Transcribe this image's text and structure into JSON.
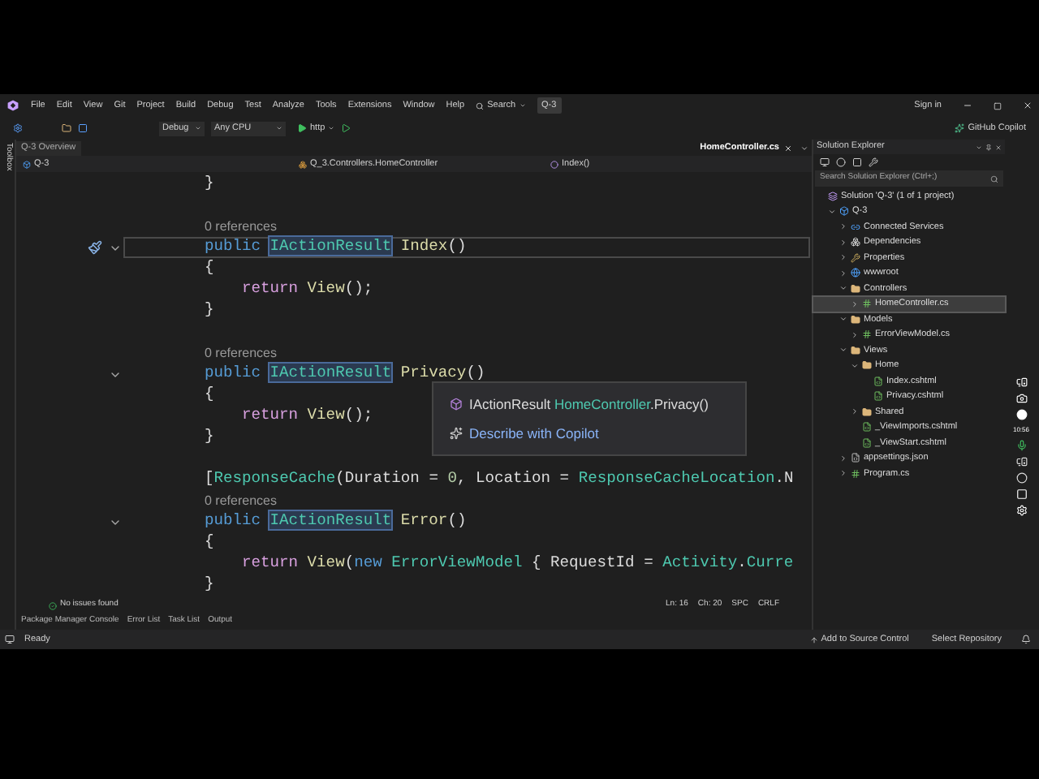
{
  "menu": {
    "items": [
      "File",
      "Edit",
      "View",
      "Git",
      "Project",
      "Build",
      "Debug",
      "Test",
      "Analyze",
      "Tools",
      "Extensions",
      "Window",
      "Help"
    ],
    "search_label": "Search",
    "solution_badge": "Q-3",
    "account": "Sign in"
  },
  "toolbar": {
    "configuration": "Debug",
    "platform": "Any CPU",
    "run_target": "http",
    "copilot_label": "GitHub Copilot"
  },
  "toolbox_label": "Toolbox",
  "document_tabs": [
    {
      "label": "Q-3 Overview",
      "selected": false
    },
    {
      "label": "HomeController.cs",
      "selected": true
    }
  ],
  "nav_bar": {
    "project": "Q-3",
    "class": "Q_3.Controllers.HomeController",
    "member": "Index()"
  },
  "code": {
    "lines": [
      {
        "kind": "code",
        "tokens": [
          {
            "plain": "}"
          }
        ]
      },
      {
        "kind": "blank"
      },
      {
        "kind": "codelens",
        "text": "0 references"
      },
      {
        "kind": "code",
        "current": true,
        "fold": true,
        "action": true,
        "tokens": [
          {
            "keyword": "public"
          },
          {
            "type": "IActionResult",
            "highlighted": true,
            "gap": true
          },
          {
            "method": "Index",
            "gap": true
          },
          {
            "plain": "()"
          }
        ]
      },
      {
        "kind": "code",
        "tokens": [
          {
            "plain": "{"
          }
        ]
      },
      {
        "kind": "statement",
        "tokens": [
          {
            "control": "return"
          },
          {
            "method": "View",
            "gap": true
          },
          {
            "plain": "();"
          }
        ]
      },
      {
        "kind": "code",
        "tokens": [
          {
            "plain": "}"
          }
        ]
      },
      {
        "kind": "blank"
      },
      {
        "kind": "codelens",
        "text": "0 references"
      },
      {
        "kind": "code",
        "current": false,
        "fold": true,
        "tokens": [
          {
            "keyword": "public"
          },
          {
            "type": "IActionResult",
            "highlighted": true,
            "gap": true
          },
          {
            "method": "Privacy",
            "gap": true
          },
          {
            "plain": "()"
          }
        ]
      },
      {
        "kind": "code",
        "tokens": [
          {
            "plain": "{"
          }
        ]
      },
      {
        "kind": "statement",
        "tokens": [
          {
            "control": "return"
          },
          {
            "method": "View",
            "gap": true
          },
          {
            "plain": "();"
          }
        ]
      },
      {
        "kind": "code",
        "tokens": [
          {
            "plain": "}"
          }
        ]
      },
      {
        "kind": "blank"
      },
      {
        "kind": "code",
        "tokens": [
          {
            "plain": "["
          },
          {
            "type": "ResponseCache"
          },
          {
            "plain": "(Duration"
          },
          {
            "plain": "=",
            "gap": true
          },
          {
            "number": "0",
            "gap": true
          },
          {
            "plain": ", Location ="
          },
          {
            "type": "ResponseCacheLocation",
            "gap": true
          },
          {
            "plain": ".N"
          }
        ]
      },
      {
        "kind": "codelens",
        "text": "0 references"
      },
      {
        "kind": "code",
        "current": false,
        "fold": true,
        "tokens": [
          {
            "keyword": "public"
          },
          {
            "type": "IActionResult",
            "highlighted": true,
            "gap": true
          },
          {
            "method": "Error",
            "gap": true
          },
          {
            "plain": "()"
          }
        ]
      },
      {
        "kind": "code",
        "tokens": [
          {
            "plain": "{"
          }
        ]
      },
      {
        "kind": "statement",
        "tokens": [
          {
            "control": "return"
          },
          {
            "method": "View",
            "gap": true
          },
          {
            "plain": "("
          },
          {
            "keyword": "new"
          },
          {
            "type": "ErrorViewModel",
            "gap": true
          },
          {
            "plain": "{ RequestId =",
            "gap": true
          },
          {
            "type": "Activity",
            "gap": true
          },
          {
            "plain": "."
          },
          {
            "type": "Curre"
          }
        ]
      },
      {
        "kind": "code",
        "tokens": [
          {
            "plain": "}"
          }
        ]
      }
    ]
  },
  "tooltip": {
    "signature": [
      {
        "plain": "IActionResult"
      },
      {
        "type": "HomeController",
        "gap": true
      },
      {
        "plain": ".Privacy()"
      }
    ],
    "action": "Describe with Copilot"
  },
  "editor_status": {
    "issues": "No issues found",
    "line": "Ln: 16",
    "column": "Ch: 20",
    "spacing": "SPC",
    "line_ending": "CRLF"
  },
  "bottom_tabs": [
    "Package Manager Console",
    "Error List",
    "Task List",
    "Output"
  ],
  "status_bar": {
    "text": "Ready",
    "source_control": "Add to Source Control",
    "repository": "Select Repository"
  },
  "solution_explorer": {
    "title": "Solution Explorer",
    "search_placeholder": "Search Solution Explorer (Ctrl+;)",
    "tree": [
      {
        "label": "Solution 'Q-3' (1 of 1 project)",
        "kind": "solution",
        "selected": false,
        "children": [
          {
            "label": "Q-3",
            "kind": "project",
            "expanded": true,
            "selected": false,
            "children": [
              {
                "label": "Connected Services",
                "kind": "service",
                "expanded": false,
                "selected": false
              },
              {
                "label": "Dependencies",
                "kind": "dependencies",
                "expanded": false,
                "selected": false
              },
              {
                "label": "Properties",
                "kind": "properties",
                "expanded": false,
                "selected": false
              },
              {
                "label": "wwwroot",
                "kind": "globe",
                "expanded": false,
                "selected": false
              },
              {
                "label": "Controllers",
                "kind": "folder",
                "expanded": true,
                "selected": false,
                "children": [
                  {
                    "label": "HomeController.cs",
                    "kind": "csharp",
                    "expanded": false,
                    "selected": true
                  }
                ]
              },
              {
                "label": "Models",
                "kind": "folder",
                "expanded": true,
                "selected": false,
                "children": [
                  {
                    "label": "ErrorViewModel.cs",
                    "kind": "csharp",
                    "expanded": false,
                    "selected": false
                  }
                ]
              },
              {
                "label": "Views",
                "kind": "folder",
                "expanded": true,
                "selected": false,
                "children": [
                  {
                    "label": "Home",
                    "kind": "folder",
                    "expanded": true,
                    "selected": false,
                    "children": [
                      {
                        "label": "Index.cshtml",
                        "kind": "razor",
                        "selected": false
                      },
                      {
                        "label": "Privacy.cshtml",
                        "kind": "razor",
                        "selected": false
                      }
                    ]
                  },
                  {
                    "label": "Shared",
                    "kind": "folder",
                    "expanded": false,
                    "selected": false
                  },
                  {
                    "label": "_ViewImports.cshtml",
                    "kind": "razor",
                    "selected": false
                  },
                  {
                    "label": "_ViewStart.cshtml",
                    "kind": "razor",
                    "selected": false
                  }
                ]
              },
              {
                "label": "appsettings.json",
                "kind": "json",
                "expanded": false,
                "selected": false
              },
              {
                "label": "Program.cs",
                "kind": "csharp",
                "expanded": false,
                "selected": false
              }
            ]
          }
        ]
      }
    ]
  },
  "recorder": {
    "time": "10:56"
  }
}
